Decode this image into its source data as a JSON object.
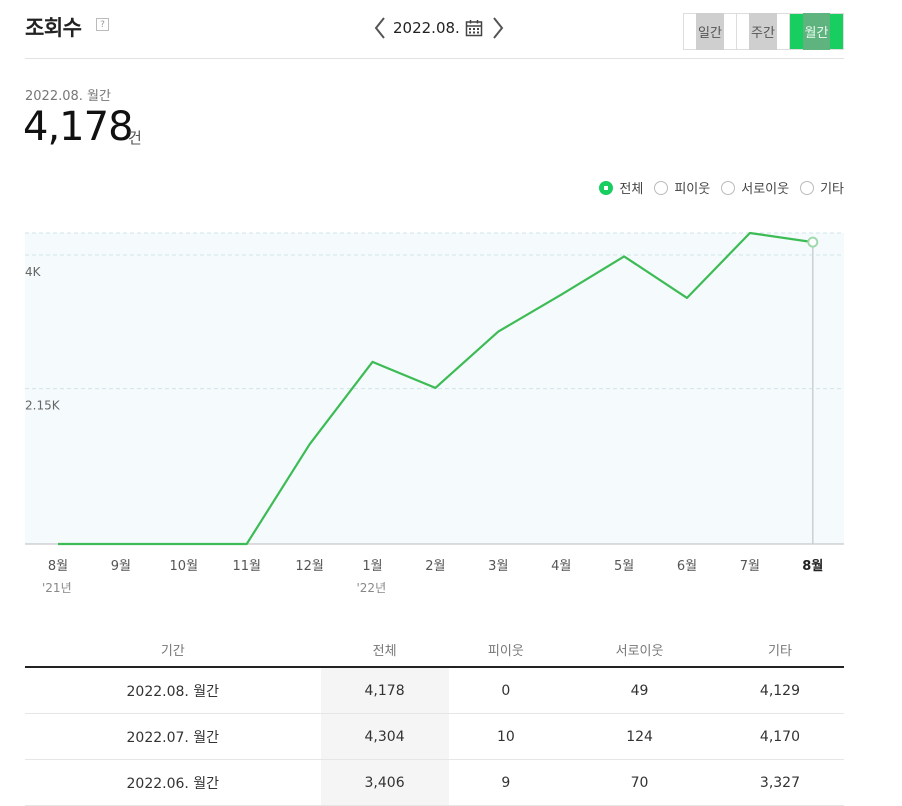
{
  "header": {
    "title": "조회수",
    "help": "?",
    "date": "2022.08.",
    "periods": [
      {
        "label": "일간",
        "active": false
      },
      {
        "label": "주간",
        "active": false
      },
      {
        "label": "월간",
        "active": true
      }
    ]
  },
  "summary": {
    "label": "2022.08. 월간",
    "value": "4,178",
    "unit": "건"
  },
  "legend": [
    {
      "label": "전체",
      "selected": true
    },
    {
      "label": "피이웃",
      "selected": false
    },
    {
      "label": "서로이웃",
      "selected": false
    },
    {
      "label": "기타",
      "selected": false
    }
  ],
  "colors": {
    "accent": "#19ce60",
    "line": "#3dbb55",
    "plot_bg": "#f5fbfc"
  },
  "chart_data": {
    "type": "line",
    "categories": [
      "8월",
      "9월",
      "10월",
      "11월",
      "12월",
      "1월",
      "2월",
      "3월",
      "4월",
      "5월",
      "6월",
      "7월",
      "8월"
    ],
    "year_labels": [
      {
        "index": 0,
        "label": "'21년"
      },
      {
        "index": 5,
        "label": "'22년"
      }
    ],
    "series": [
      {
        "values": [
          0,
          0,
          0,
          0,
          1380,
          2520,
          2160,
          2940,
          3450,
          3980,
          3406,
          4304,
          4178
        ]
      }
    ],
    "yticks": [
      {
        "value": 2150,
        "label": "2.15K"
      },
      {
        "value": 4000,
        "label": "4K"
      }
    ],
    "ylim": [
      0,
      4304
    ],
    "grid": true,
    "highlight_index": 12
  },
  "table": {
    "columns": [
      "기간",
      "전체",
      "피이웃",
      "서로이웃",
      "기타"
    ],
    "rows": [
      [
        "2022.08. 월간",
        "4,178",
        "0",
        "49",
        "4,129"
      ],
      [
        "2022.07. 월간",
        "4,304",
        "10",
        "124",
        "4,170"
      ],
      [
        "2022.06. 월간",
        "3,406",
        "9",
        "70",
        "3,327"
      ]
    ]
  }
}
